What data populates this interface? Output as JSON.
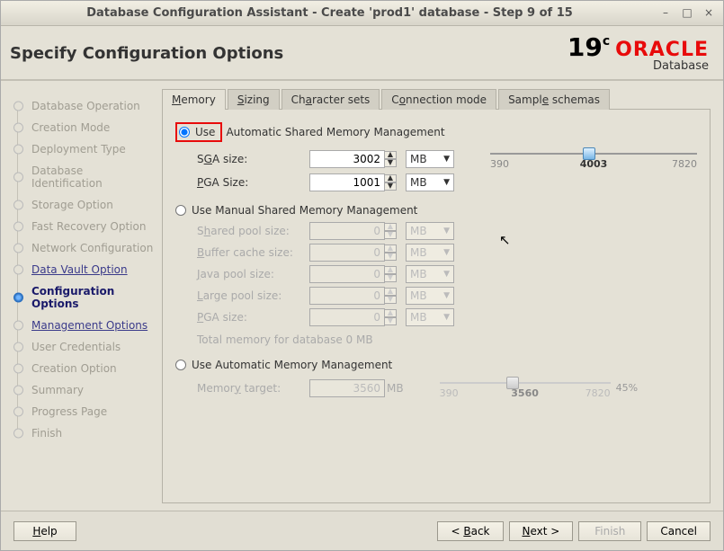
{
  "titlebar": {
    "title": "Database Configuration Assistant - Create 'prod1' database - Step 9 of 15"
  },
  "heading": "Specify Configuration Options",
  "logo": {
    "ver": "19",
    "sup": "c",
    "brand": "ORACLE",
    "sub": "Database"
  },
  "steps": {
    "items": [
      {
        "label": "Database Operation"
      },
      {
        "label": "Creation Mode"
      },
      {
        "label": "Deployment Type"
      },
      {
        "label": "Database Identification"
      },
      {
        "label": "Storage Option"
      },
      {
        "label": "Fast Recovery Option"
      },
      {
        "label": "Network Configuration"
      },
      {
        "label": "Data Vault Option"
      },
      {
        "label": "Configuration Options"
      },
      {
        "label": "Management Options"
      },
      {
        "label": "User Credentials"
      },
      {
        "label": "Creation Option"
      },
      {
        "label": "Summary"
      },
      {
        "label": "Progress Page"
      },
      {
        "label": "Finish"
      }
    ]
  },
  "tabs": {
    "items": [
      "Memory",
      "Sizing",
      "Character sets",
      "Connection mode",
      "Sample schemas"
    ],
    "mn": [
      "M",
      "S",
      "a",
      "o",
      "e"
    ]
  },
  "memory": {
    "auto_shared_label": "Use Automatic Shared Memory Management",
    "manual_label": "Use Manual Shared Memory Management",
    "auto_label": "Use Automatic Memory Management",
    "sga_label": "SGA size:",
    "pga_label": "PGA Size:",
    "sga_value": "3002",
    "pga_value": "1001",
    "unit": "MB",
    "slider": {
      "min": "390",
      "mid": "4003",
      "max": "7820"
    },
    "manual": {
      "shared_pool": {
        "label": "Shared pool size:",
        "value": "0"
      },
      "buffer_cache": {
        "label": "Buffer cache size:",
        "value": "0"
      },
      "java_pool": {
        "label": "Java pool size:",
        "value": "0"
      },
      "large_pool": {
        "label": "Large pool size:",
        "value": "0"
      },
      "pga": {
        "label": "PGA size:",
        "value": "0"
      }
    },
    "total_label": "Total memory for database 0 MB",
    "auto_target": {
      "label": "Memory target:",
      "value": "3560",
      "unit": "MB",
      "min": "390",
      "mid": "3560",
      "max": "7820",
      "pct": "45%"
    }
  },
  "footer": {
    "help": "Help",
    "back": "< Back",
    "next": "Next >",
    "finish": "Finish",
    "cancel": "Cancel"
  }
}
